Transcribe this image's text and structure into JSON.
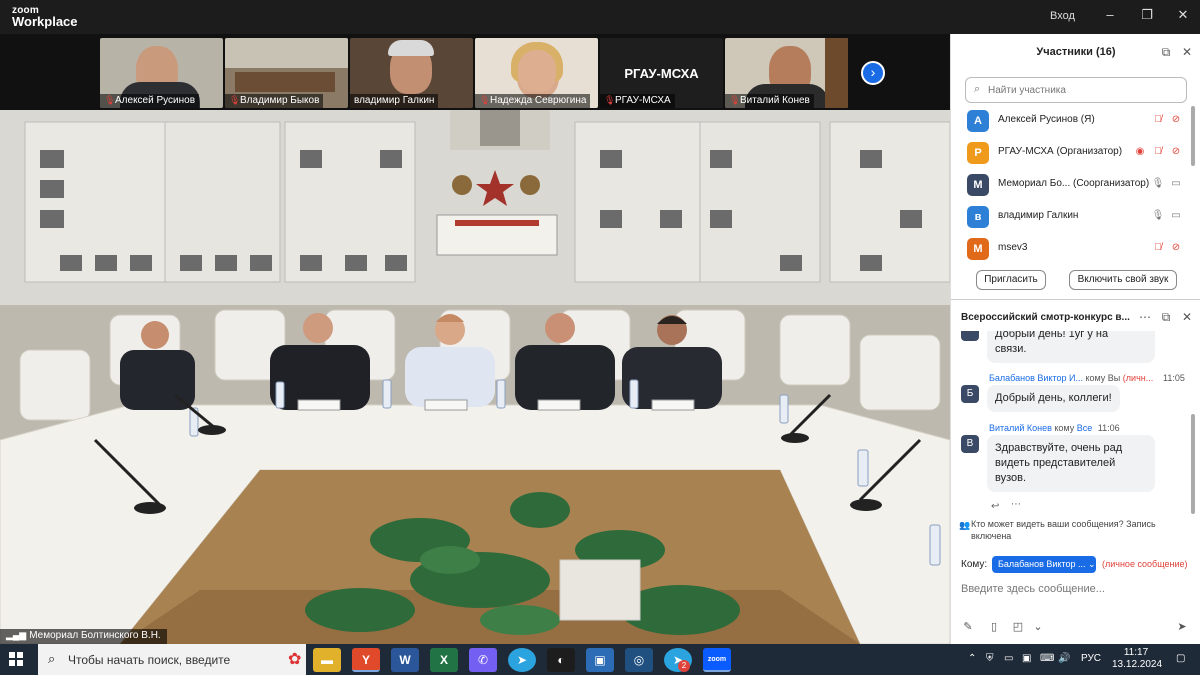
{
  "app": {
    "logo_line1": "zoom",
    "logo_line2": "Workplace",
    "signin": "Вход"
  },
  "thumbnails": [
    {
      "name": "Алексей Русинов"
    },
    {
      "name": "Владимир Быков"
    },
    {
      "name": "владимир Галкин"
    },
    {
      "name": "Надежда Севрюгина"
    },
    {
      "name": "РГАУ-МСХА",
      "label": "РГАУ-МСХА"
    },
    {
      "name": "Виталий Конев"
    }
  ],
  "main_video": {
    "name": "Мемориал Болтинского В.Н."
  },
  "participants": {
    "title": "Участники (16)",
    "search_placeholder": "Найти участника",
    "list": [
      {
        "initial": "А",
        "name": "Алексей Русинов (Я)",
        "color": "#2e7fd6"
      },
      {
        "initial": "Р",
        "name": "РГАУ-МСХА (Организатор)",
        "color": "#f09a1c"
      },
      {
        "initial": "М",
        "name": "Мемориал Бо...  (Соорганизатор)",
        "color": "#3a4a66"
      },
      {
        "initial": "в",
        "name": "владимир Галкин",
        "color": "#2e7fd6"
      },
      {
        "initial": "М",
        "name": "msev3",
        "color": "#e06a1a"
      }
    ],
    "invite_label": "Пригласить",
    "unmute_label": "Включить свой звук"
  },
  "chat": {
    "title": "Всероссийский смотр-конкурс в...",
    "messages": [
      {
        "text_line1": "Добрый день! 1уг у на",
        "text_line2": "связи."
      },
      {
        "initial": "Б",
        "sender": "Балабанов Виктор И...",
        "to": "кому Вы",
        "private": "(личн...",
        "time": "11:05",
        "text": "Добрый день, коллеги!"
      },
      {
        "initial": "В",
        "sender": "Виталий Конев",
        "to": "кому",
        "audience": "Все",
        "time": "11:06",
        "text": "Здравствуйте, очень рад видеть представителей вузов."
      }
    ],
    "notice": "Кто может видеть ваши сообщения? Запись включена",
    "to_label": "Кому:",
    "to_value": "Балабанов Виктор ...",
    "to_private": "(личное сообщение)",
    "input_placeholder": "Введите здесь сообщение..."
  },
  "taskbar": {
    "search_text": "Чтобы начать поиск, введите",
    "lang": "РУС",
    "time": "11:17",
    "date": "13.12.2024",
    "telegram_badge": "2"
  },
  "colors": {
    "zoom_blue": "#1a6ce6",
    "muted_red": "#e0433b",
    "taskbar": "#1f2a38"
  }
}
